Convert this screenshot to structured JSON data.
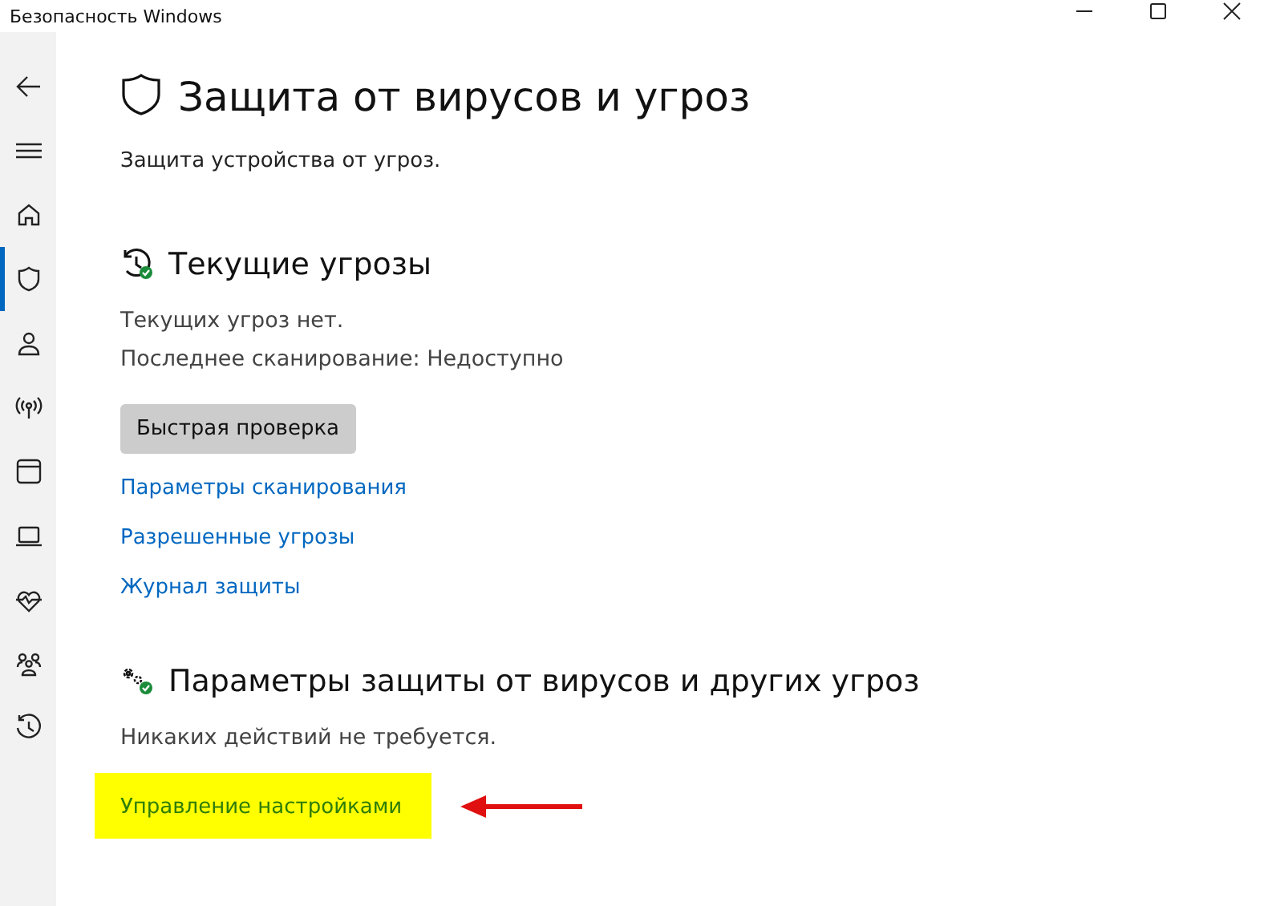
{
  "window": {
    "title": "Безопасность Windows"
  },
  "nav": [
    {
      "kind": "back",
      "selected": false
    },
    {
      "kind": "menu",
      "selected": false
    },
    {
      "kind": "home",
      "selected": false
    },
    {
      "kind": "shield",
      "selected": true
    },
    {
      "kind": "person",
      "selected": false
    },
    {
      "kind": "wireless",
      "selected": false
    },
    {
      "kind": "browser",
      "selected": false
    },
    {
      "kind": "laptop",
      "selected": false
    },
    {
      "kind": "heart",
      "selected": false
    },
    {
      "kind": "family",
      "selected": false
    },
    {
      "kind": "history",
      "selected": false
    }
  ],
  "page": {
    "title": "Защита от вирусов и угроз",
    "subtitle": "Защита устройства от угроз."
  },
  "sections": [
    {
      "kind": "threats",
      "title": "Текущие угрозы",
      "lines": [
        "Текущих угроз нет.",
        "Последнее сканирование: Недоступно"
      ],
      "button": "Быстрая проверка",
      "links": [
        {
          "label": "Параметры сканирования",
          "highlighted": false
        },
        {
          "label": "Разрешенные угрозы",
          "highlighted": false
        },
        {
          "label": "Журнал защиты",
          "highlighted": false
        }
      ]
    },
    {
      "kind": "settings",
      "title": "Параметры защиты от вирусов и других угроз",
      "lines": [
        "Никаких действий не требуется."
      ],
      "links": [
        {
          "label": "Управление настройками",
          "highlighted": true
        }
      ]
    }
  ]
}
